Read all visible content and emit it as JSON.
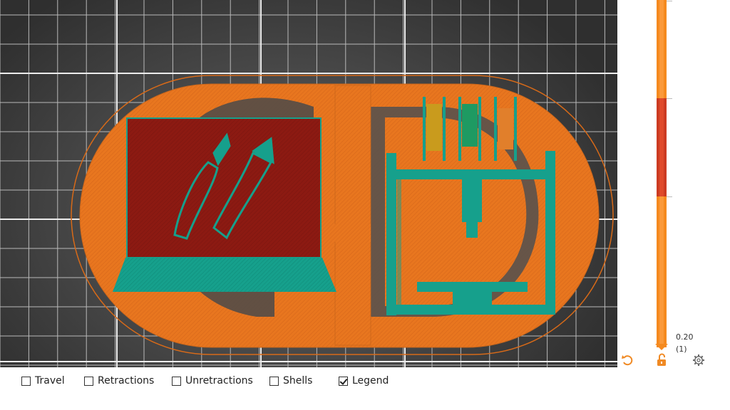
{
  "viewport": {
    "bed_grid_color": "#b9b9b9",
    "bed_major_line_color": "#ececec",
    "object_color": "#e8761f",
    "object_outline_color": "#c9661b",
    "skirt_color": "#d86a18",
    "screen_color": "#8c1a12",
    "teal_color": "#16a08c",
    "filament_colors": [
      "#c99b1d",
      "#1e9a62",
      "#e17f2b"
    ]
  },
  "layer_slider": {
    "height_label": "0.20",
    "index_label": "(1)",
    "track_color": "#f58a1f",
    "selected_color": "#cc3b22"
  },
  "icons": {
    "undo": "undo-icon",
    "lock": "lock-open-icon",
    "settings": "gear-icon"
  },
  "options": [
    {
      "key": "travel",
      "label": "Travel",
      "checked": false
    },
    {
      "key": "retractions",
      "label": "Retractions",
      "checked": false
    },
    {
      "key": "unretractions",
      "label": "Unretractions",
      "checked": false
    },
    {
      "key": "shells",
      "label": "Shells",
      "checked": false
    },
    {
      "key": "legend",
      "label": "Legend",
      "checked": true
    }
  ]
}
